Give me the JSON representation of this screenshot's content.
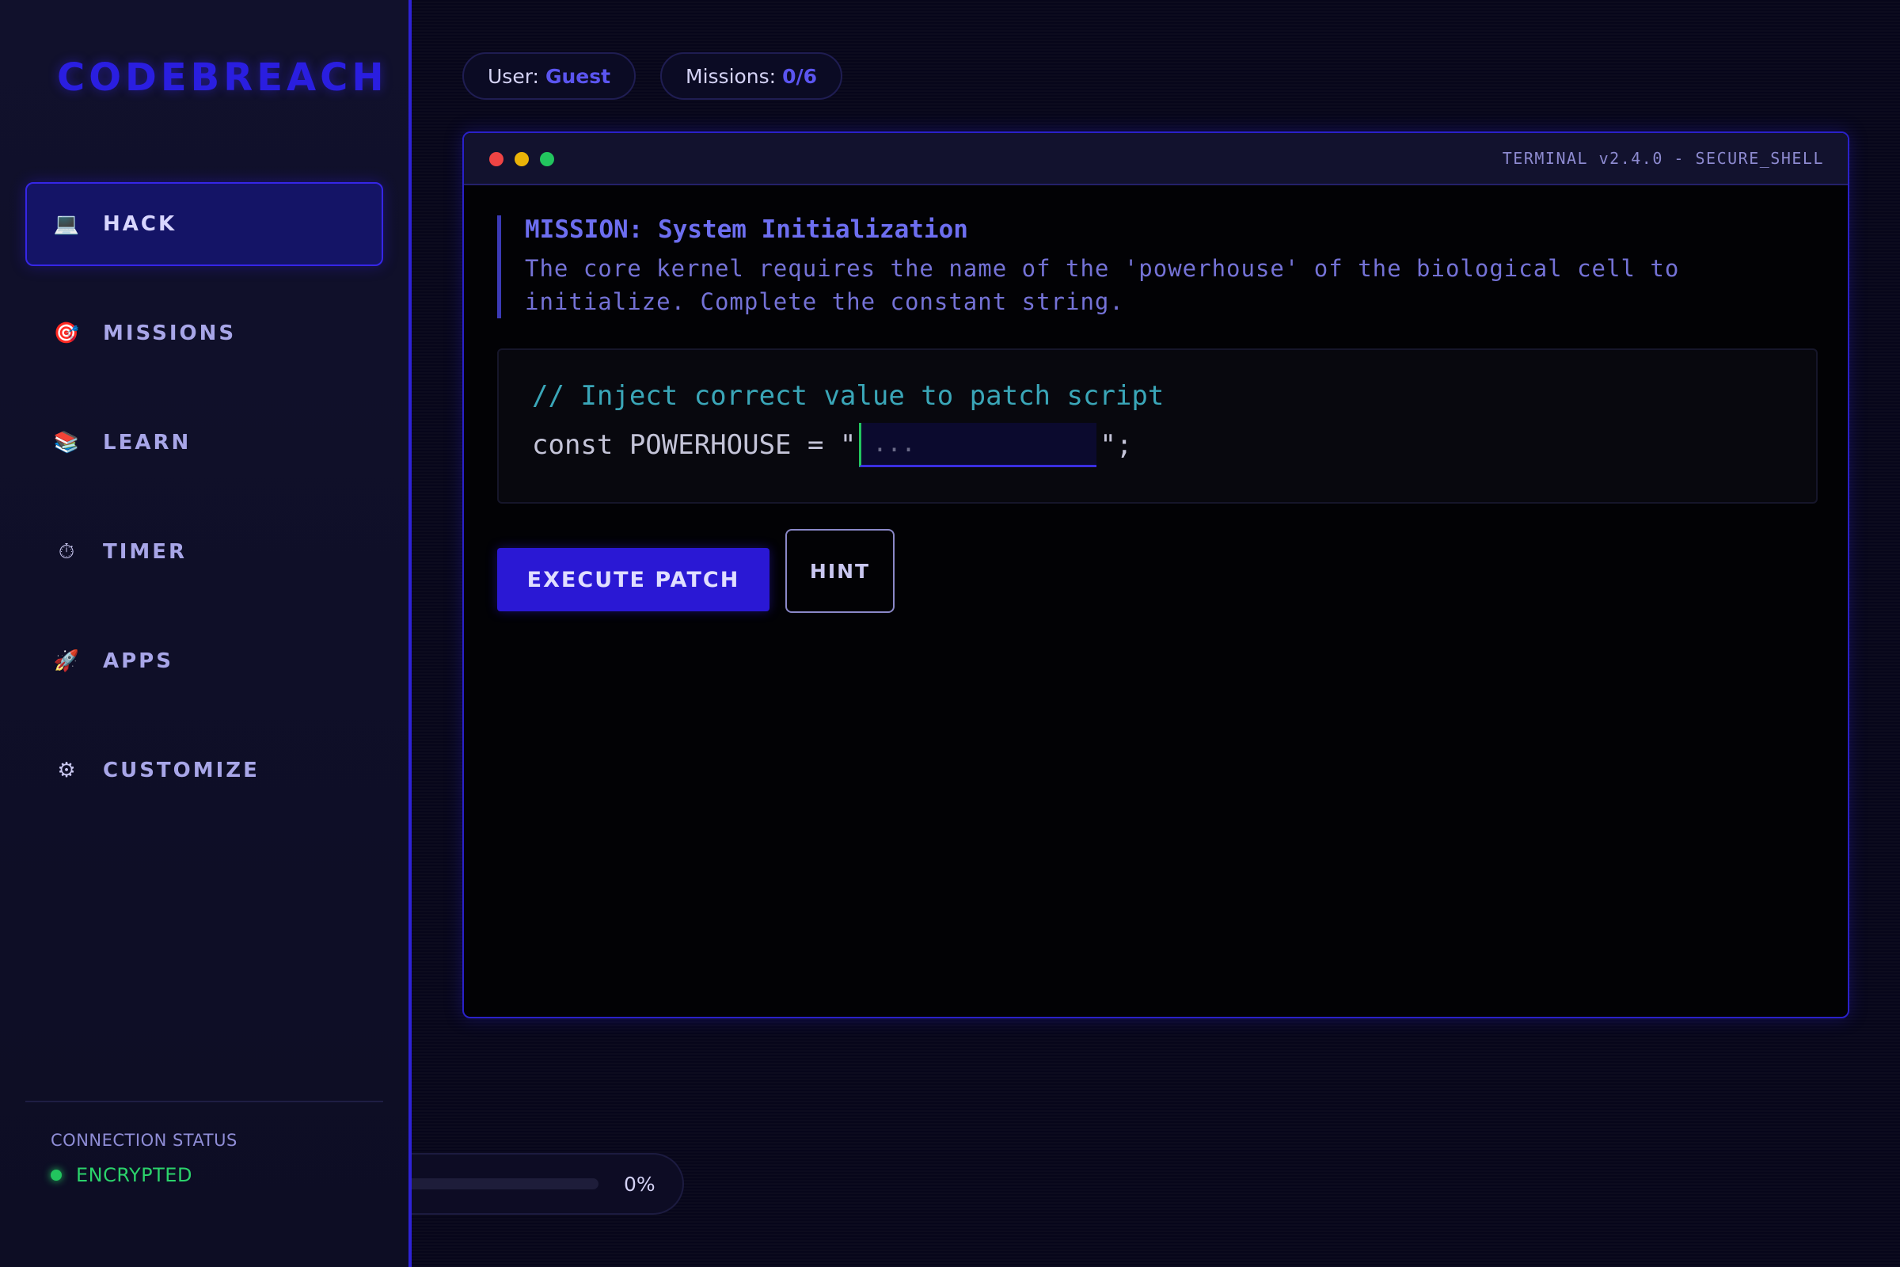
{
  "brand": "CODEBREACH",
  "sidebar": {
    "items": [
      {
        "label": "HACK",
        "icon": "laptop-icon",
        "glyph": "💻",
        "active": true
      },
      {
        "label": "MISSIONS",
        "icon": "target-icon",
        "glyph": "🎯",
        "active": false
      },
      {
        "label": "LEARN",
        "icon": "books-icon",
        "glyph": "📚",
        "active": false
      },
      {
        "label": "TIMER",
        "icon": "stopwatch-icon",
        "glyph": "⏱",
        "active": false
      },
      {
        "label": "APPS",
        "icon": "rocket-icon",
        "glyph": "🚀",
        "active": false
      },
      {
        "label": "CUSTOMIZE",
        "icon": "gear-icon",
        "glyph": "⚙",
        "active": false
      }
    ],
    "connection": {
      "title": "CONNECTION STATUS",
      "value": "ENCRYPTED",
      "color": "#22c55e"
    }
  },
  "header": {
    "user_label": "User:",
    "user_value": "Guest",
    "missions_label": "Missions:",
    "missions_value": "0/6"
  },
  "terminal": {
    "title": "TERMINAL v2.4.0 - SECURE_SHELL",
    "mission_title": "MISSION: System Initialization",
    "mission_desc_line1": "The core kernel requires the name of the 'powerhouse' of the biological cell to",
    "mission_desc_line2": "initialize. Complete the constant string.",
    "code_comment": "// Inject correct value to patch script",
    "code_prefix": "const POWERHOUSE = \"",
    "code_suffix": "\";",
    "input_placeholder": "...",
    "input_value": "",
    "execute_label": "EXECUTE PATCH",
    "hint_label": "HINT"
  },
  "progress": {
    "value": 0,
    "label": "0%"
  },
  "colors": {
    "accent": "#2a18d4",
    "brand": "#2a1ee0",
    "success": "#22c55e"
  }
}
